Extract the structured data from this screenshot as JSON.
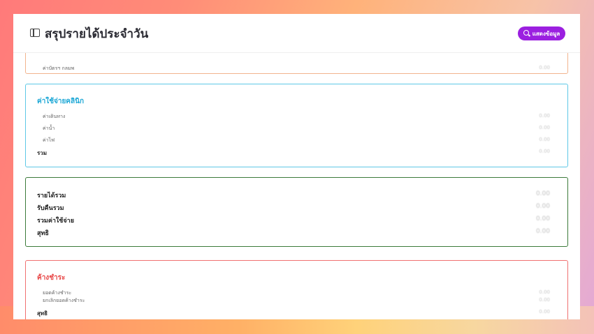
{
  "header": {
    "title": "สรุปรายได้ประจำวัน",
    "show_button": "แสดงข้อมูล",
    "toggle_icon": "sidebar-toggle-icon",
    "search_icon": "search-icon"
  },
  "cards": {
    "top": {
      "row_label": "ค่าบัตรฯ กลมพ",
      "row_value": "0.00",
      "border_color": "#f2b48e"
    },
    "clinic": {
      "title": "ค่าใช้จ่ายคลินิก",
      "title_color": "#1ea8d6",
      "border_color": "#5ec8e6",
      "rows": [
        {
          "label": "ค่าเดินทาง",
          "value": "0.00"
        },
        {
          "label": "ค่าน้ำ",
          "value": "0.00"
        },
        {
          "label": "ค่าไฟ",
          "value": "0.00"
        }
      ],
      "total_label": "รวม",
      "total_value": "0.00"
    },
    "summary": {
      "border_color": "#3b7a3a",
      "rows": [
        {
          "label": "รายได้รวม",
          "value": "0.00"
        },
        {
          "label": "รับคืนรวม",
          "value": "0.00"
        },
        {
          "label": "รวมค่าใช้จ่าย",
          "value": "0.00"
        },
        {
          "label": "สุทธิ",
          "value": "0.00"
        }
      ]
    },
    "debt": {
      "title": "ค้างชำระ",
      "title_color": "#e84848",
      "border_color": "#f07070",
      "rows": [
        {
          "label": "ยอดค้างชำระ",
          "value": "0.00"
        },
        {
          "label": "ยกเลิกยอดค้างชำระ",
          "value": "0.00"
        }
      ],
      "total_label": "สุทธิ",
      "total_value": "0.00"
    }
  }
}
